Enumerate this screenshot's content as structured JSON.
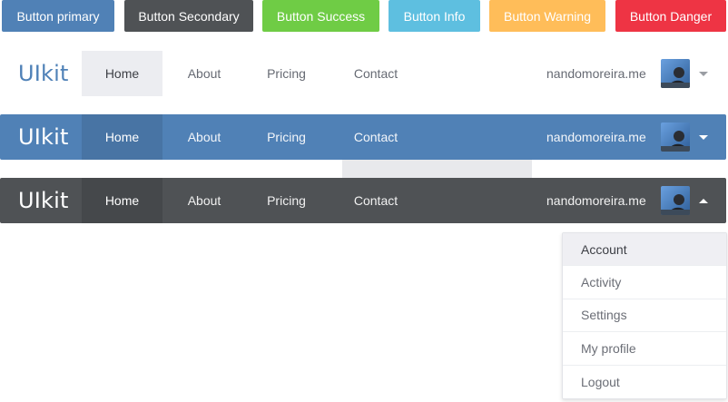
{
  "colors": {
    "primary": "#5081b6",
    "secondary": "#4f5255",
    "success": "#6fcc45",
    "info": "#5ebfe0",
    "warning": "#ffbd59",
    "danger": "#ee3444"
  },
  "buttons": [
    {
      "label": "Button primary",
      "color": "#5081b6"
    },
    {
      "label": "Button Secondary",
      "color": "#4f5255"
    },
    {
      "label": "Button Success",
      "color": "#6fcc45"
    },
    {
      "label": "Button Info",
      "color": "#5ebfe0"
    },
    {
      "label": "Button Warning",
      "color": "#ffbd59"
    },
    {
      "label": "Button Danger",
      "color": "#ee3444"
    }
  ],
  "navbars": [
    {
      "variant": "light",
      "brand": "UIkit",
      "items": [
        "Home",
        "About",
        "Pricing",
        "Contact"
      ],
      "active": "Home",
      "user": "nandomoreira.me",
      "caret": "chevron-down-icon"
    },
    {
      "variant": "primary",
      "brand": "UIkit",
      "items": [
        "Home",
        "About",
        "Pricing",
        "Contact"
      ],
      "active": "Home",
      "user": "nandomoreira.me",
      "caret": "chevron-down-icon"
    },
    {
      "variant": "dark",
      "brand": "UIkit",
      "items": [
        "Home",
        "About",
        "Pricing",
        "Contact"
      ],
      "active": "Home",
      "user": "nandomoreira.me",
      "caret": "chevron-up-icon"
    }
  ],
  "dropdown": {
    "items": [
      "Account",
      "Activity",
      "Settings",
      "My profile",
      "Logout"
    ],
    "active": "Account"
  }
}
